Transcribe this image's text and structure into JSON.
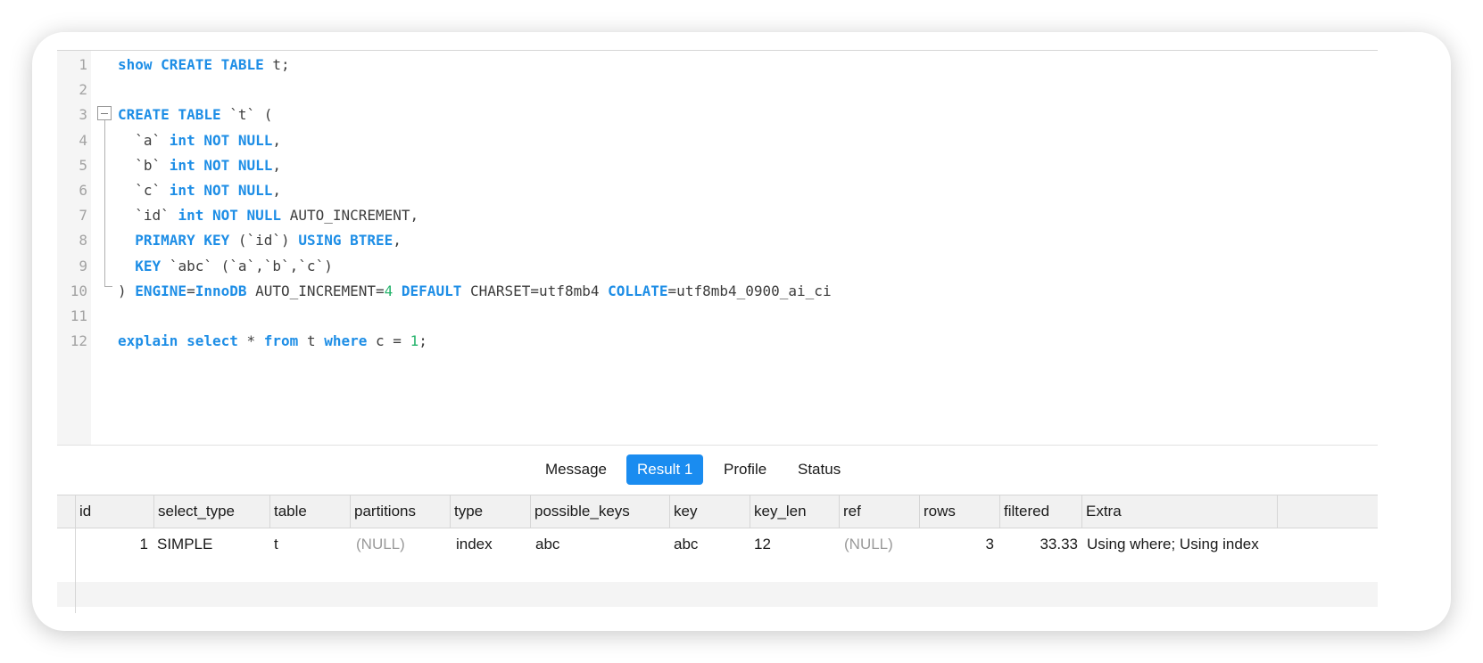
{
  "editor": {
    "lines": [
      {
        "n": "1",
        "tokens": [
          {
            "t": "show",
            "k": "kw"
          },
          {
            "t": " "
          },
          {
            "t": "CREATE",
            "k": "kw"
          },
          {
            "t": " "
          },
          {
            "t": "TABLE",
            "k": "kw"
          },
          {
            "t": " t;"
          }
        ]
      },
      {
        "n": "2",
        "tokens": []
      },
      {
        "n": "3",
        "tokens": [
          {
            "t": "CREATE",
            "k": "kw"
          },
          {
            "t": " "
          },
          {
            "t": "TABLE",
            "k": "kw"
          },
          {
            "t": " `t` ("
          }
        ]
      },
      {
        "n": "4",
        "tokens": [
          {
            "t": "  `a` "
          },
          {
            "t": "int",
            "k": "kw"
          },
          {
            "t": " "
          },
          {
            "t": "NOT",
            "k": "kw"
          },
          {
            "t": " "
          },
          {
            "t": "NULL",
            "k": "kw"
          },
          {
            "t": ","
          }
        ]
      },
      {
        "n": "5",
        "tokens": [
          {
            "t": "  `b` "
          },
          {
            "t": "int",
            "k": "kw"
          },
          {
            "t": " "
          },
          {
            "t": "NOT",
            "k": "kw"
          },
          {
            "t": " "
          },
          {
            "t": "NULL",
            "k": "kw"
          },
          {
            "t": ","
          }
        ]
      },
      {
        "n": "6",
        "tokens": [
          {
            "t": "  `c` "
          },
          {
            "t": "int",
            "k": "kw"
          },
          {
            "t": " "
          },
          {
            "t": "NOT",
            "k": "kw"
          },
          {
            "t": " "
          },
          {
            "t": "NULL",
            "k": "kw"
          },
          {
            "t": ","
          }
        ]
      },
      {
        "n": "7",
        "tokens": [
          {
            "t": "  `id` "
          },
          {
            "t": "int",
            "k": "kw"
          },
          {
            "t": " "
          },
          {
            "t": "NOT",
            "k": "kw"
          },
          {
            "t": " "
          },
          {
            "t": "NULL",
            "k": "kw"
          },
          {
            "t": " AUTO_INCREMENT,"
          }
        ]
      },
      {
        "n": "8",
        "tokens": [
          {
            "t": "  "
          },
          {
            "t": "PRIMARY",
            "k": "kw"
          },
          {
            "t": " "
          },
          {
            "t": "KEY",
            "k": "kw"
          },
          {
            "t": " (`id`) "
          },
          {
            "t": "USING",
            "k": "kw"
          },
          {
            "t": " "
          },
          {
            "t": "BTREE",
            "k": "kw"
          },
          {
            "t": ","
          }
        ]
      },
      {
        "n": "9",
        "tokens": [
          {
            "t": "  "
          },
          {
            "t": "KEY",
            "k": "kw"
          },
          {
            "t": " `abc` (`a`,`b`,`c`)"
          }
        ]
      },
      {
        "n": "10",
        "tokens": [
          {
            "t": ") "
          },
          {
            "t": "ENGINE",
            "k": "kw"
          },
          {
            "t": "="
          },
          {
            "t": "InnoDB",
            "k": "kw"
          },
          {
            "t": " AUTO_INCREMENT="
          },
          {
            "t": "4",
            "k": "num"
          },
          {
            "t": " "
          },
          {
            "t": "DEFAULT",
            "k": "kw"
          },
          {
            "t": " CHARSET=utf8mb4 "
          },
          {
            "t": "COLLATE",
            "k": "kw"
          },
          {
            "t": "=utf8mb4_0900_ai_ci"
          }
        ]
      },
      {
        "n": "11",
        "tokens": []
      },
      {
        "n": "12",
        "tokens": [
          {
            "t": "explain",
            "k": "kw"
          },
          {
            "t": " "
          },
          {
            "t": "select",
            "k": "kw"
          },
          {
            "t": " * "
          },
          {
            "t": "from",
            "k": "kw"
          },
          {
            "t": " t "
          },
          {
            "t": "where",
            "k": "kw"
          },
          {
            "t": " c = "
          },
          {
            "t": "1",
            "k": "num"
          },
          {
            "t": ";"
          }
        ]
      }
    ]
  },
  "tabs": [
    {
      "label": "Message",
      "active": false
    },
    {
      "label": "Result 1",
      "active": true
    },
    {
      "label": "Profile",
      "active": false
    },
    {
      "label": "Status",
      "active": false
    }
  ],
  "result": {
    "columns": [
      "id",
      "select_type",
      "table",
      "partitions",
      "type",
      "possible_keys",
      "key",
      "key_len",
      "ref",
      "rows",
      "filtered",
      "Extra"
    ],
    "rows": [
      [
        "1",
        "SIMPLE",
        "t",
        "(NULL)",
        "index",
        "abc",
        "abc",
        "12",
        "(NULL)",
        "3",
        "33.33",
        "Using where; Using index"
      ]
    ]
  },
  "colors": {
    "keyword": "#1e8ee6",
    "number": "#24b36b",
    "active_tab": "#1a8cf0"
  }
}
